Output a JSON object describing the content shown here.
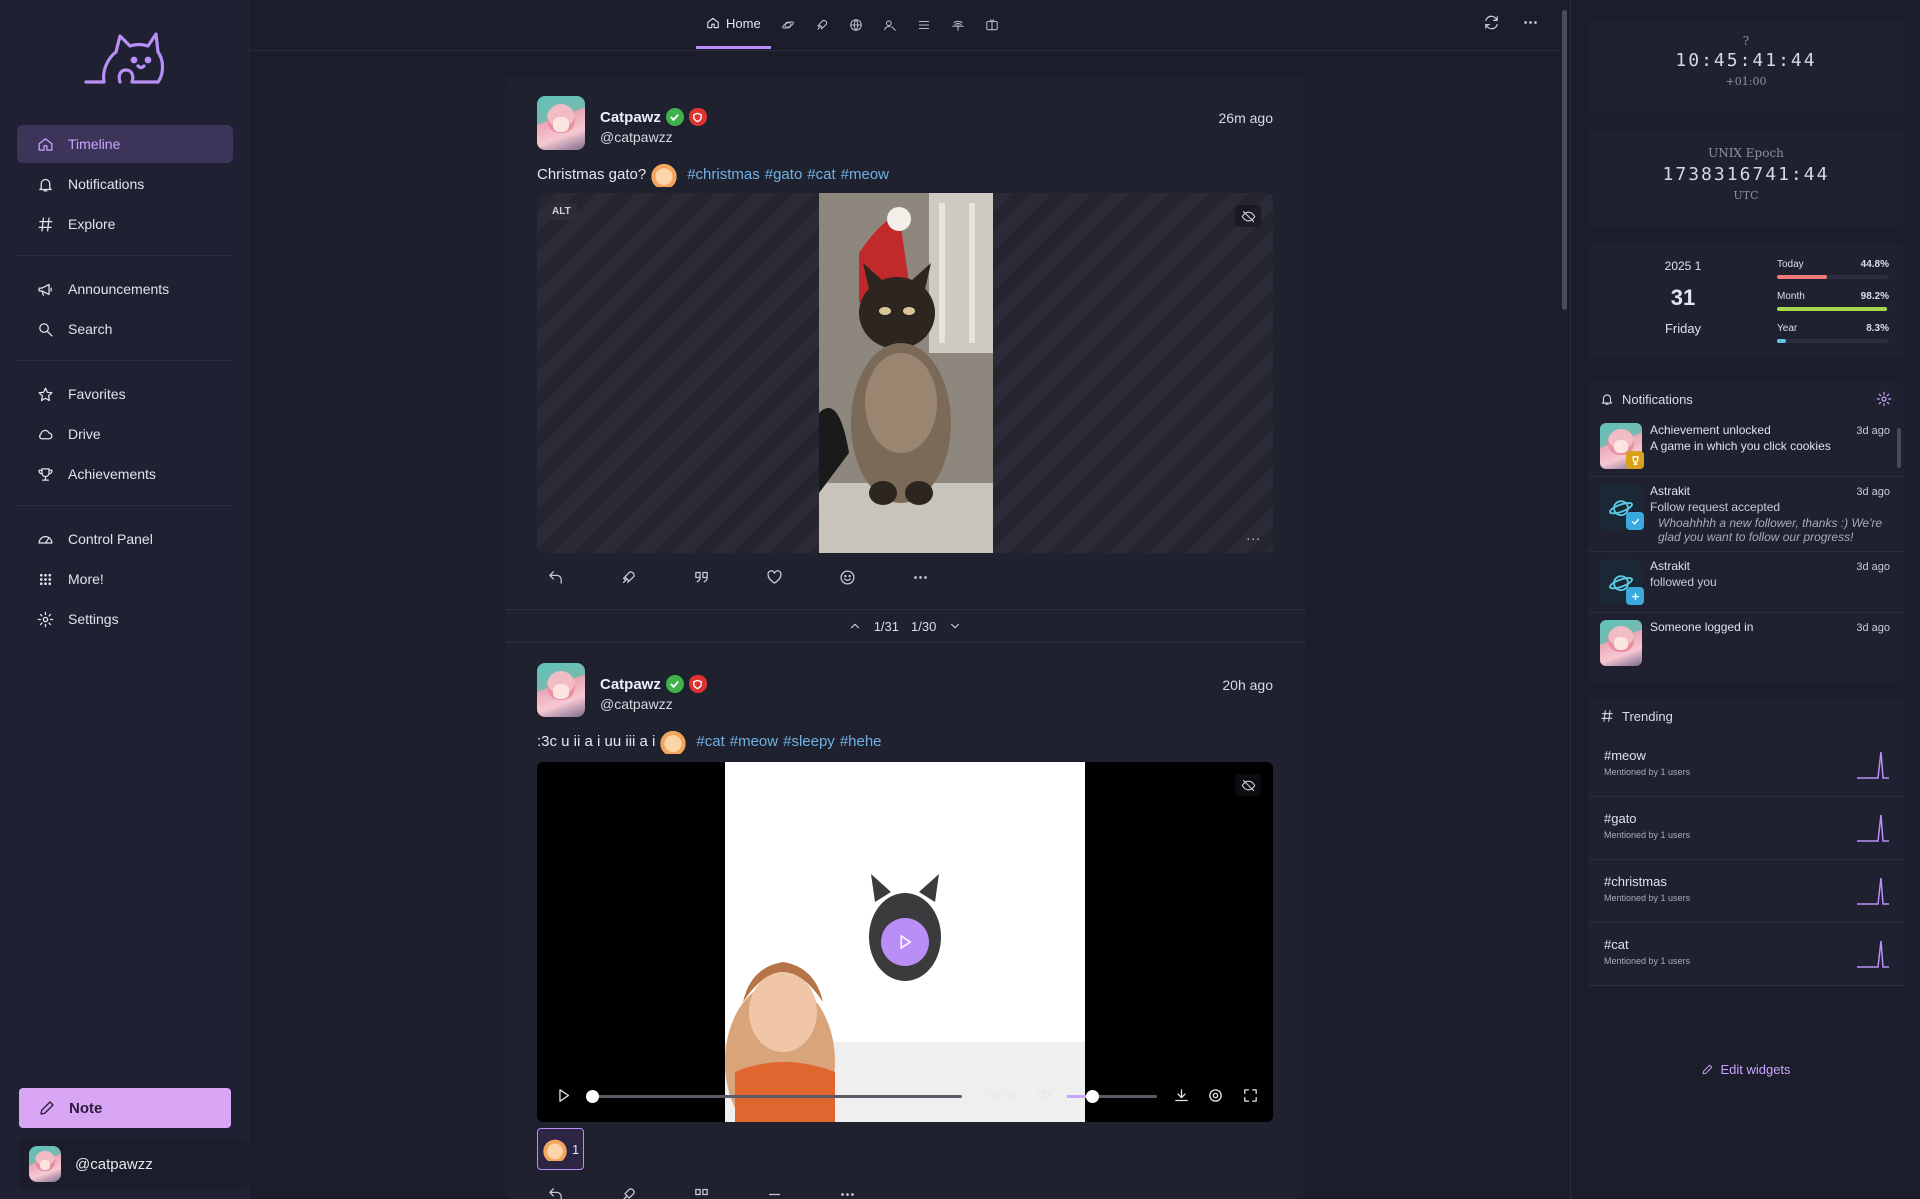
{
  "sidebar": {
    "items": [
      {
        "label": "Timeline",
        "icon": "home-icon"
      },
      {
        "label": "Notifications",
        "icon": "bell-icon"
      },
      {
        "label": "Explore",
        "icon": "hash-icon"
      },
      {
        "label": "Announcements",
        "icon": "megaphone-icon"
      },
      {
        "label": "Search",
        "icon": "search-icon"
      },
      {
        "label": "Favorites",
        "icon": "star-icon"
      },
      {
        "label": "Drive",
        "icon": "cloud-icon"
      },
      {
        "label": "Achievements",
        "icon": "trophy-icon"
      },
      {
        "label": "Control Panel",
        "icon": "gauge-icon"
      },
      {
        "label": "More!",
        "icon": "grid-dots-icon"
      },
      {
        "label": "Settings",
        "icon": "gear-icon"
      }
    ],
    "note_button": "Note",
    "account": "@catpawzz"
  },
  "topbar": {
    "home_tab": "Home"
  },
  "posts": [
    {
      "display_name": "Catpawz",
      "username": "@catpawzz",
      "time": "26m ago",
      "text": "Christmas gato?",
      "hashtags": [
        "#christmas",
        "#gato",
        "#cat",
        "#meow"
      ],
      "alt_label": "ALT",
      "more": "...",
      "pager_prev": "1/31",
      "pager_next": "1/30"
    },
    {
      "display_name": "Catpawz",
      "username": "@catpawzz",
      "time": "20h ago",
      "text": ":3c u ii a i uu iii a i",
      "hashtags": [
        "#cat",
        "#meow",
        "#sleepy",
        "#hehe"
      ],
      "video_time": "00:00",
      "reaction_count": "1"
    }
  ],
  "clock": {
    "label": "?",
    "time": "10:45:41:44",
    "offset": "+01:00"
  },
  "unix": {
    "label": "UNIX Epoch",
    "value": "1738316741:44",
    "zone": "UTC"
  },
  "calendar": {
    "year_month": "2025  1",
    "day": "31",
    "weekday": "Friday",
    "progress": [
      {
        "label": "Today",
        "value": "44.8%",
        "fraction": 0.448,
        "color": "#f0797a"
      },
      {
        "label": "Month",
        "value": "98.2%",
        "fraction": 0.982,
        "color": "#a6d94d"
      },
      {
        "label": "Year",
        "value": "8.3%",
        "fraction": 0.083,
        "color": "#5cc8e6"
      }
    ]
  },
  "notifications": {
    "title": "Notifications",
    "items": [
      {
        "title": "Achievement unlocked",
        "detail": "A game in which you click cookies",
        "ago": "3d ago"
      },
      {
        "title": "Astrakit",
        "detail": "Follow request accepted",
        "quote": "Whoahhhh a new follower, thanks :) We're glad you want to follow our progress!",
        "ago": "3d ago"
      },
      {
        "title": "Astrakit",
        "detail": "followed you",
        "ago": "3d ago"
      },
      {
        "title": "Someone logged in",
        "ago": "3d ago"
      }
    ]
  },
  "trending": {
    "title": "Trending",
    "items": [
      {
        "tag": "#meow",
        "mentions": "Mentioned by 1 users"
      },
      {
        "tag": "#gato",
        "mentions": "Mentioned by 1 users"
      },
      {
        "tag": "#christmas",
        "mentions": "Mentioned by 1 users"
      },
      {
        "tag": "#cat",
        "mentions": "Mentioned by 1 users"
      }
    ]
  },
  "edit_widgets": "Edit widgets",
  "colors": {
    "accent": "#b98ff7",
    "note_button": "#d9a5f5",
    "hashtag": "#6fb2e6"
  }
}
